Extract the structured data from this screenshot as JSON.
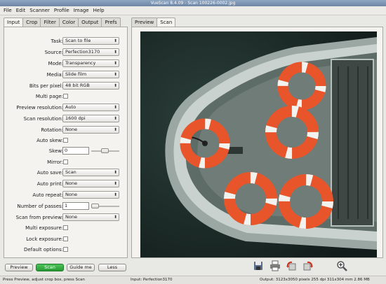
{
  "window": {
    "title": "VueScan 8.4.09 - Scan 100226-0002.jpg"
  },
  "menu": [
    "File",
    "Edit",
    "Scanner",
    "Profile",
    "Image",
    "Help"
  ],
  "left_tabs": [
    "Input",
    "Crop",
    "Filter",
    "Color",
    "Output",
    "Prefs"
  ],
  "right_tabs": [
    "Preview",
    "Scan"
  ],
  "settings": {
    "task": {
      "label": "Task:",
      "value": "Scan to file"
    },
    "source": {
      "label": "Source:",
      "value": "Perfection3170"
    },
    "mode": {
      "label": "Mode:",
      "value": "Transparency"
    },
    "media": {
      "label": "Media:",
      "value": "Slide film"
    },
    "bits_per_pixel": {
      "label": "Bits per pixel:",
      "value": "48 bit RGB"
    },
    "multi_page": {
      "label": "Multi page:"
    },
    "preview_resolution": {
      "label": "Preview resolution:",
      "value": "Auto"
    },
    "scan_resolution": {
      "label": "Scan resolution:",
      "value": "1600 dpi"
    },
    "rotation": {
      "label": "Rotation:",
      "value": "None"
    },
    "auto_skew": {
      "label": "Auto skew:"
    },
    "skew": {
      "label": "Skew:",
      "value": "0"
    },
    "mirror": {
      "label": "Mirror:"
    },
    "auto_save": {
      "label": "Auto save:",
      "value": "Scan"
    },
    "auto_print": {
      "label": "Auto print:",
      "value": "None"
    },
    "auto_repeat": {
      "label": "Auto repeat:",
      "value": "None"
    },
    "number_of_passes": {
      "label": "Number of passes:",
      "value": "1"
    },
    "scan_from_preview": {
      "label": "Scan from preview:",
      "value": "None"
    },
    "multi_exposure": {
      "label": "Multi exposure:"
    },
    "lock_exposure": {
      "label": "Lock exposure:"
    },
    "default_options": {
      "label": "Default options:"
    }
  },
  "buttons": {
    "preview": "Preview",
    "scan": "Scan",
    "guide_me": "Guide me",
    "less": "Less"
  },
  "toolbar_icons": [
    "save-icon",
    "print-icon",
    "rotate-left-icon",
    "rotate-right-icon",
    "zoom-icon"
  ],
  "status": {
    "hint": "Press Preview, adjust crop box, press Scan",
    "input": "Input: Perfection3170",
    "output": "Output: 3123x3050 pixels 255 dpi 311x304 mm 2.86 MB"
  },
  "colors": {
    "scan_button": "#2fa83b",
    "life_ring": "#e8552a",
    "water": "#1e2c29"
  }
}
